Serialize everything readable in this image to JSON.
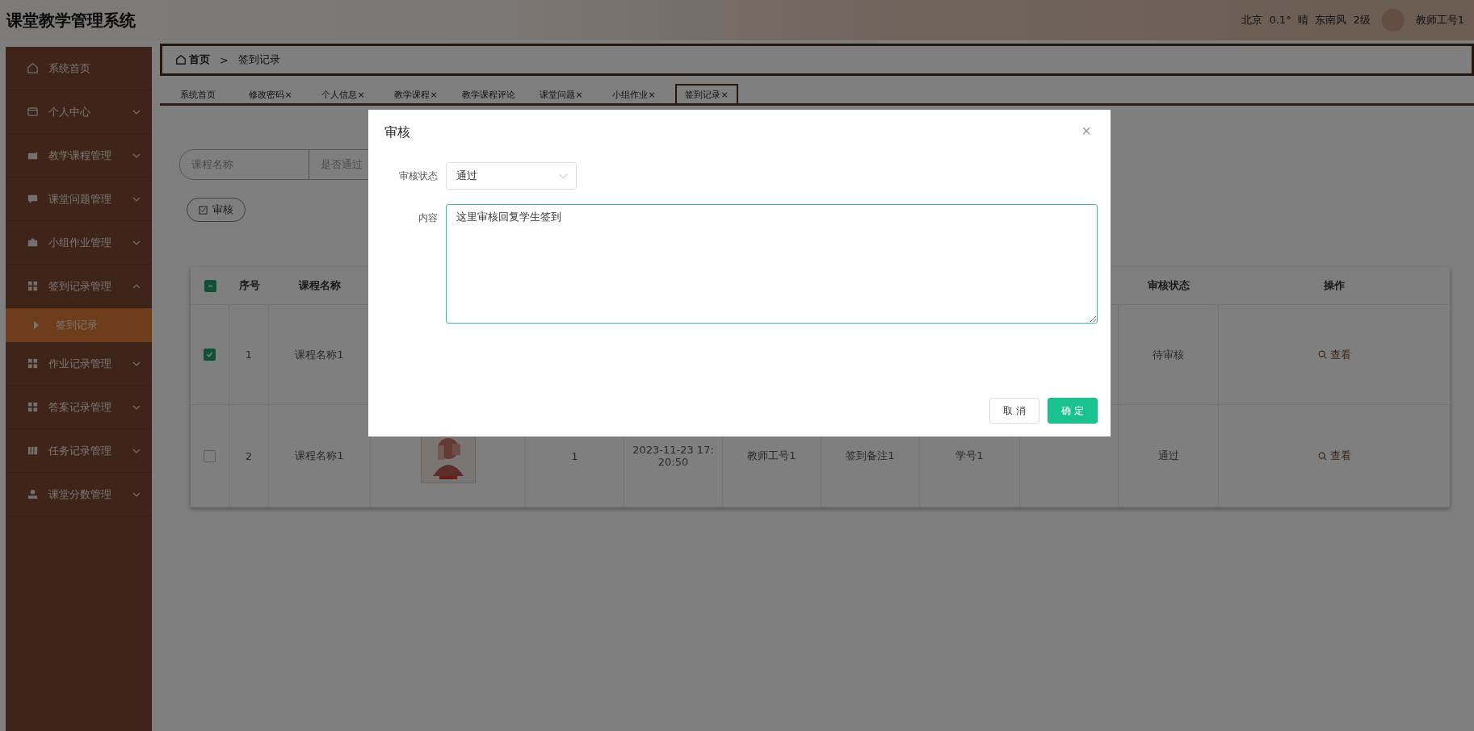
{
  "header": {
    "title": "课堂教学管理系统",
    "weather": "北京  0.1°  晴  东南风  2级",
    "user": "教师工号1"
  },
  "sidebar": {
    "items": [
      {
        "kind": "link",
        "label": "系统首页",
        "selected": false
      },
      {
        "kind": "group",
        "label": "个人中心",
        "selected": false,
        "expanded": false
      },
      {
        "kind": "group",
        "label": "教学课程管理",
        "selected": false,
        "expanded": false
      },
      {
        "kind": "group",
        "label": "课堂问题管理",
        "selected": false,
        "expanded": false
      },
      {
        "kind": "group",
        "label": "小组作业管理",
        "selected": false,
        "expanded": false
      },
      {
        "kind": "group",
        "label": "签到记录管理",
        "selected": false,
        "expanded": true,
        "children": [
          {
            "label": "签到记录",
            "selected": true
          }
        ]
      },
      {
        "kind": "group",
        "label": "作业记录管理",
        "selected": false,
        "expanded": false
      },
      {
        "kind": "group",
        "label": "答案记录管理",
        "selected": false,
        "expanded": false
      },
      {
        "kind": "group",
        "label": "任务记录管理",
        "selected": false,
        "expanded": false
      },
      {
        "kind": "group",
        "label": "课堂分数管理",
        "selected": false,
        "expanded": false
      }
    ]
  },
  "breadcrumb": {
    "items": [
      "首页",
      "签到记录"
    ],
    "separator": ">"
  },
  "tabs": [
    {
      "label": "系统首页",
      "selected": false
    },
    {
      "label": "修改密码",
      "close": "×",
      "selected": false
    },
    {
      "label": "个人信息",
      "close": "×",
      "selected": false
    },
    {
      "label": "教学课程",
      "close": "×",
      "selected": false
    },
    {
      "label": "教学课程评论",
      "selected": false
    },
    {
      "label": "课堂问题",
      "close": "×",
      "selected": false
    },
    {
      "label": "小组作业",
      "close": "×",
      "selected": false
    },
    {
      "label": "签到记录",
      "close": "×",
      "selected": true
    }
  ],
  "search": {
    "fields": [
      {
        "placeholder": "课程名称"
      },
      {
        "placeholder": "是否通过"
      }
    ]
  },
  "actions": [
    {
      "label": "审核"
    }
  ],
  "table": {
    "indeterminate": true,
    "columns": [
      "序号",
      "课程名称",
      null,
      null,
      null,
      null,
      null,
      null,
      null,
      "审核状态",
      "操作"
    ],
    "rows": [
      {
        "checked": true,
        "cells": [
          "1",
          "课程名称1",
          null,
          null,
          null,
          null,
          null,
          null,
          null,
          "待审核"
        ],
        "action": "查看"
      },
      {
        "checked": false,
        "cells": [
          "2",
          "课程名称1",
          {
            "kind": "picture"
          },
          "1",
          "2023-11-23 17:20:50",
          "教师工号1",
          "签到备注1",
          "学号1",
          null,
          "通过"
        ],
        "action": "查看"
      }
    ]
  },
  "dialog": {
    "title": "审核",
    "close": "×",
    "fields": [
      {
        "kind": "select",
        "label": "审核状态",
        "value": "通过"
      },
      {
        "kind": "textarea",
        "label": "内容",
        "value": "这里审核回复学生签到"
      }
    ],
    "buttons": [
      {
        "label": "取 消",
        "primary": false
      },
      {
        "label": "确 定",
        "primary": true
      }
    ]
  }
}
